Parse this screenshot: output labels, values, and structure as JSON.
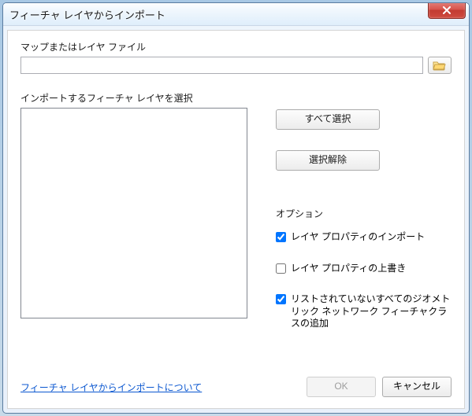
{
  "window": {
    "title": "フィーチャ レイヤからインポート"
  },
  "file": {
    "label": "マップまたはレイヤ ファイル",
    "value": ""
  },
  "listbox_label": "インポートするフィーチャ レイヤを選択",
  "side_buttons": {
    "select_all": "すべて選択",
    "clear_selection": "選択解除"
  },
  "options": {
    "title": "オプション",
    "import_props": {
      "label": "レイヤ プロパティのインポート",
      "checked": true
    },
    "overwrite_props": {
      "label": "レイヤ プロパティの上書き",
      "checked": false
    },
    "add_unlisted": {
      "label": "リストされていないすべてのジオメトリック ネットワーク フィーチャクラスの追加",
      "checked": true
    }
  },
  "footer": {
    "help_link": "フィーチャ レイヤからインポートについて",
    "ok": "OK",
    "cancel": "キャンセル",
    "ok_enabled": false
  },
  "colors": {
    "link": "#0b57d0",
    "close_bg": "#c23b31"
  }
}
